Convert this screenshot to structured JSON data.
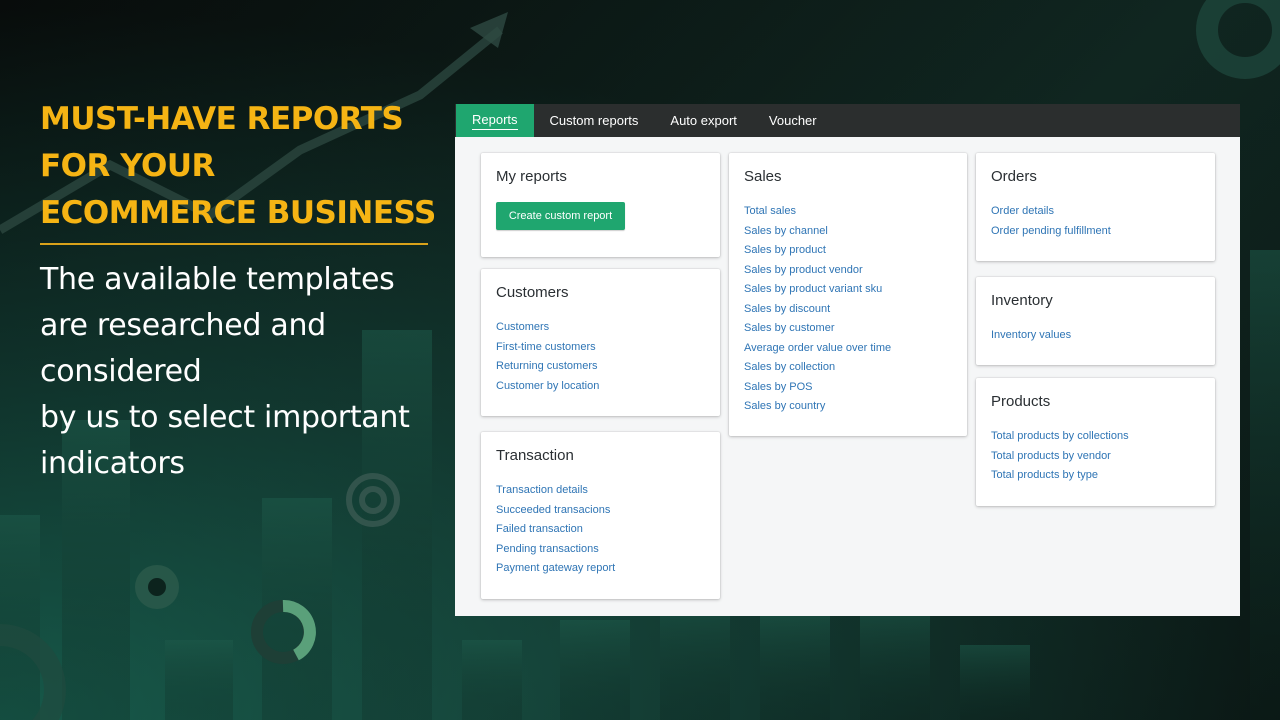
{
  "promo": {
    "title_lines": [
      "MUST-HAVE REPORTS",
      "FOR YOUR",
      "ECOMMERCE BUSINESS"
    ],
    "body_lines": [
      "The available templates",
      "are researched and",
      "considered",
      "by us to select important",
      "indicators"
    ]
  },
  "colors": {
    "accent_green": "#1fa66f",
    "title_gold": "#f5b414",
    "link_blue": "#2f75b5",
    "tabbar_dark": "#2b2e2e"
  },
  "tabs": [
    {
      "label": "Reports",
      "active": true
    },
    {
      "label": "Custom reports",
      "active": false
    },
    {
      "label": "Auto export",
      "active": false
    },
    {
      "label": "Voucher",
      "active": false
    }
  ],
  "cards": {
    "my_reports": {
      "title": "My reports",
      "button_label": "Create custom report"
    },
    "customers": {
      "title": "Customers",
      "links": [
        "Customers",
        "First-time customers",
        "Returning customers",
        "Customer by location"
      ]
    },
    "transaction": {
      "title": "Transaction",
      "links": [
        "Transaction details",
        "Succeeded transacions",
        "Failed transaction",
        "Pending transactions",
        "Payment gateway report"
      ]
    },
    "sales": {
      "title": "Sales",
      "links": [
        "Total sales",
        "Sales by channel",
        "Sales by product",
        "Sales by product vendor",
        "Sales by product variant sku",
        "Sales by discount",
        "Sales by customer",
        "Average order value over time",
        "Sales by collection",
        "Sales by POS",
        "Sales by country"
      ]
    },
    "orders": {
      "title": "Orders",
      "links": [
        "Order details",
        "Order pending fulfillment"
      ]
    },
    "inventory": {
      "title": "Inventory",
      "links": [
        "Inventory values"
      ]
    },
    "products": {
      "title": "Products",
      "links": [
        "Total products by collections",
        "Total products by vendor",
        "Total products by type"
      ]
    }
  }
}
